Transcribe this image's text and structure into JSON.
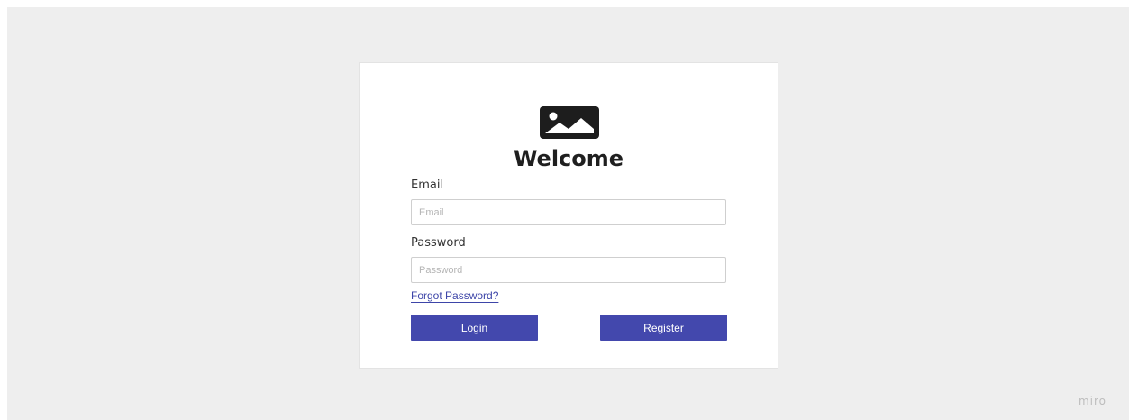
{
  "login_card": {
    "logo_icon": "image-icon",
    "title": "Welcome",
    "email": {
      "label": "Email",
      "placeholder": "Email",
      "value": ""
    },
    "password": {
      "label": "Password",
      "placeholder": "Password",
      "value": ""
    },
    "forgot_password_link": "Forgot Password?",
    "login_button": "Login",
    "register_button": "Register"
  },
  "watermark": "miro",
  "colors": {
    "background": "#eeeeee",
    "card": "#ffffff",
    "primary_button": "#4348ad",
    "link": "#3d45a8",
    "text": "#1f1f1f"
  }
}
